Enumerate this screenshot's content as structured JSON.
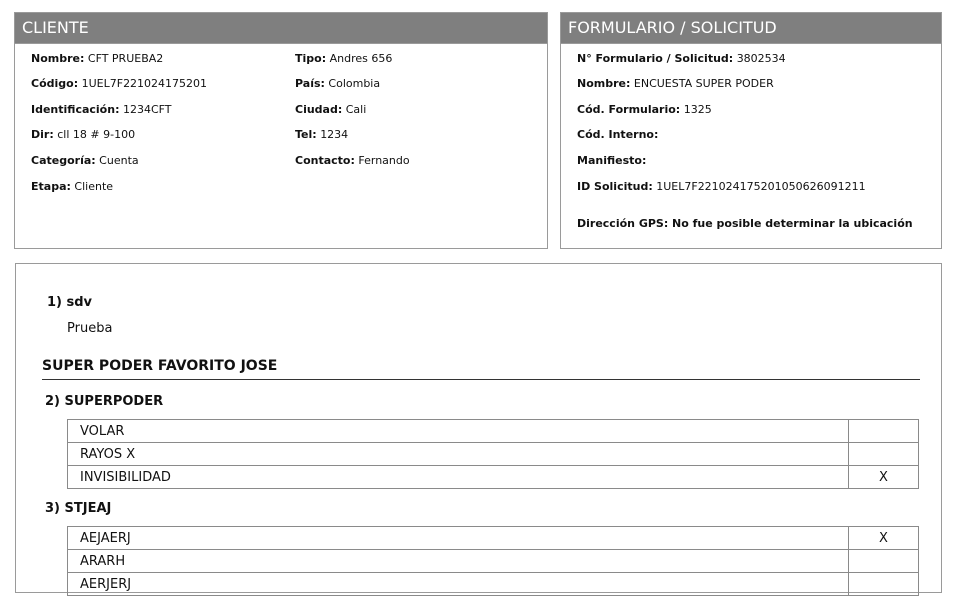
{
  "cliente": {
    "title": "CLIENTE",
    "col1": [
      {
        "label": "Nombre:",
        "value": "CFT PRUEBA2"
      },
      {
        "label": "Código:",
        "value": "1UEL7F221024175201"
      },
      {
        "label": "Identificación:",
        "value": "1234CFT"
      },
      {
        "label": "Dir:",
        "value": "cll 18 # 9-100"
      },
      {
        "label": "Categoría:",
        "value": "Cuenta"
      },
      {
        "label": "Etapa:",
        "value": "Cliente"
      }
    ],
    "col2": [
      {
        "label": "Tipo:",
        "value": "Andres 656"
      },
      {
        "label": "País:",
        "value": "Colombia"
      },
      {
        "label": "Ciudad:",
        "value": "Cali"
      },
      {
        "label": "Tel:",
        "value": "1234"
      },
      {
        "label": "Contacto:",
        "value": "Fernando"
      }
    ]
  },
  "formulario": {
    "title": "FORMULARIO / SOLICITUD",
    "fields": [
      {
        "label": "N° Formulario / Solicitud:",
        "value": "3802534"
      },
      {
        "label": "Nombre:",
        "value": "ENCUESTA SUPER PODER"
      },
      {
        "label": "Cód. Formulario:",
        "value": "1325"
      },
      {
        "label": "Cód. Interno:",
        "value": ""
      },
      {
        "label": "Manifiesto:",
        "value": ""
      },
      {
        "label": "ID Solicitud:",
        "value": "1UEL7F221024175201050626091211"
      }
    ],
    "gps": "Dirección GPS: No fue posible determinar la ubicación"
  },
  "questions": {
    "q1": {
      "title": "1) sdv",
      "answer": "Prueba"
    },
    "section": "SUPER PODER FAVORITO JOSE",
    "q2": {
      "title": "2) SUPERPODER",
      "options": [
        {
          "label": "VOLAR",
          "mark": ""
        },
        {
          "label": "RAYOS X",
          "mark": ""
        },
        {
          "label": "INVISIBILIDAD",
          "mark": "X"
        }
      ]
    },
    "q3": {
      "title": "3) STJEAJ",
      "options": [
        {
          "label": "AEJAERJ",
          "mark": "X"
        },
        {
          "label": "ARARH",
          "mark": ""
        },
        {
          "label": "AERJERJ",
          "mark": ""
        }
      ]
    }
  }
}
